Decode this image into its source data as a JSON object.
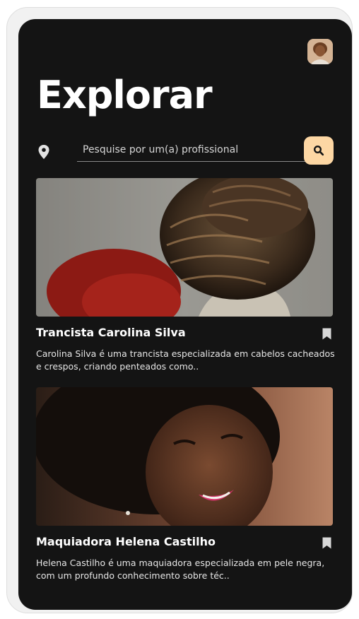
{
  "header": {
    "title": "Explorar",
    "avatar_icon": "user-avatar"
  },
  "search": {
    "placeholder": "Pesquise por um(a) profissional",
    "location_icon": "map-pin-icon",
    "button_icon": "search-icon"
  },
  "cards": [
    {
      "title": "Trancista Carolina Silva",
      "description": "Carolina Silva é uma trancista especializada em cabelos cacheados e crespos, criando penteados como..",
      "bookmark_icon": "bookmark-icon"
    },
    {
      "title": "Maquiadora Helena Castilho",
      "description": "Helena Castilho é uma maquiadora especializada em pele negra, com um profundo conhecimento sobre téc..",
      "bookmark_icon": "bookmark-icon"
    }
  ],
  "colors": {
    "background": "#141414",
    "accent": "#fdd7a4",
    "text": "#ffffff"
  }
}
